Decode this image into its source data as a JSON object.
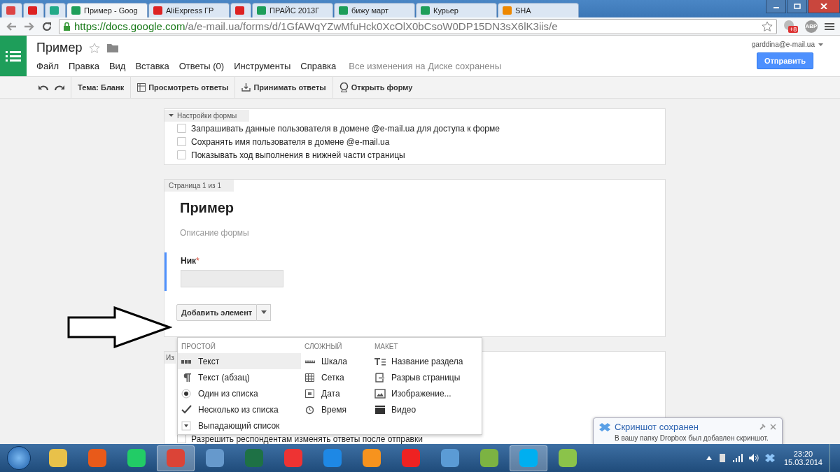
{
  "browser": {
    "tabs": [
      {
        "kind": "mail",
        "selected": false
      },
      {
        "kind": "red",
        "selected": false
      },
      {
        "kind": "drive",
        "selected": false
      },
      {
        "label": "Пример - Goog",
        "kind": "sheet",
        "selected": true
      },
      {
        "label": "AliExpress ГР",
        "kind": "red",
        "selected": false
      },
      {
        "kind": "red",
        "selected": false
      },
      {
        "label": "ПРАЙС 2013Г",
        "kind": "sheet",
        "selected": false
      },
      {
        "label": "бижу март",
        "kind": "sheet",
        "selected": false
      },
      {
        "label": "Курьер",
        "kind": "sheet",
        "selected": false
      },
      {
        "label": "SHA",
        "kind": "orange",
        "selected": false
      }
    ],
    "url": {
      "host": "https://docs.google.com",
      "path": "/a/e-mail.ua/forms/d/1GfAWqYZwMfuHck0XcOlX0bCsoW0DP15DN3sX6lK3iis/e"
    },
    "extension_badge": "+8",
    "adblock": "ABP"
  },
  "docs": {
    "title": "Пример",
    "menu": [
      "Файл",
      "Правка",
      "Вид",
      "Вставка",
      "Ответы (0)",
      "Инструменты",
      "Справка"
    ],
    "save_status": "Все изменения на Диске сохранены",
    "account": "garddina@e-mail.ua",
    "send_button": "Отправить",
    "toolbar": [
      {
        "kind": "theme",
        "label": "Тема: Бланк"
      },
      {
        "kind": "table",
        "label": "Просмотреть ответы"
      },
      {
        "kind": "download",
        "label": "Принимать ответы"
      },
      {
        "kind": "globe",
        "label": "Открыть форму"
      }
    ]
  },
  "settings": {
    "header": "Настройки формы",
    "expanded": true,
    "options": [
      {
        "label": "Запрашивать данные пользователя в домене @e-mail.ua для доступа к форме",
        "checked": false
      },
      {
        "label": "Сохранять имя пользователя в домене @e-mail.ua",
        "checked": false
      },
      {
        "label": "Показывать ход выполнения в нижней части страницы",
        "checked": false
      }
    ]
  },
  "page": {
    "header": "Страница 1 из 1",
    "form_title": "Пример",
    "description_placeholder": "Описание формы",
    "question": {
      "label": "Ник",
      "required_mark": "*"
    },
    "add_button": "Добавить элемент"
  },
  "add_menu": [
    {
      "heading": "ПРОСТОЙ",
      "items": [
        {
          "label": "Текст",
          "kind": "abc",
          "selected": true
        },
        {
          "label": "Текст (абзац)",
          "kind": "para",
          "selected": false
        },
        {
          "label": "Один из списка",
          "kind": "radio",
          "selected": false
        },
        {
          "label": "Несколько из списка",
          "kind": "check",
          "selected": false
        },
        {
          "label": "Выпадающий список",
          "kind": "dropdown",
          "selected": false
        }
      ]
    },
    {
      "heading": "СЛОЖНЫЙ",
      "items": [
        {
          "label": "Шкала",
          "kind": "scale",
          "selected": false
        },
        {
          "label": "Сетка",
          "kind": "grid",
          "selected": false
        },
        {
          "label": "Дата",
          "kind": "date",
          "selected": false
        },
        {
          "label": "Время",
          "kind": "clock",
          "selected": false
        }
      ]
    },
    {
      "heading": "МАКЕТ",
      "items": [
        {
          "label": "Название раздела",
          "kind": "heading",
          "selected": false
        },
        {
          "label": "Разрыв страницы",
          "kind": "pagebreak",
          "selected": false
        },
        {
          "label": "Изображение...",
          "kind": "image",
          "selected": false
        },
        {
          "label": "Видео",
          "kind": "video",
          "selected": false
        }
      ]
    }
  ],
  "confirm_card": {
    "header": "Из",
    "option": {
      "label": "Разрешить респондентам изменять ответы после отправки",
      "checked": false
    }
  },
  "notification": {
    "title": "Скриншот сохранен",
    "text": "В вашу папку Dropbox был добавлен скриншот."
  },
  "taskbar": {
    "apps": [
      {
        "kind": "folder",
        "selected": false
      },
      {
        "kind": "media",
        "selected": false
      },
      {
        "kind": "monitor",
        "selected": false
      },
      {
        "kind": "chrome",
        "selected": true
      },
      {
        "kind": "calculator",
        "selected": false
      },
      {
        "kind": "excel",
        "selected": false
      },
      {
        "kind": "yandex-browser",
        "selected": false
      },
      {
        "kind": "ie",
        "selected": false
      },
      {
        "kind": "ok",
        "selected": false
      },
      {
        "kind": "yandex",
        "selected": false
      },
      {
        "kind": "sound",
        "selected": false
      },
      {
        "kind": "green-ball",
        "selected": false
      },
      {
        "kind": "skype",
        "selected": true
      },
      {
        "kind": "green-app",
        "selected": false
      }
    ],
    "time": "23:20",
    "date": "15.03.2014"
  }
}
